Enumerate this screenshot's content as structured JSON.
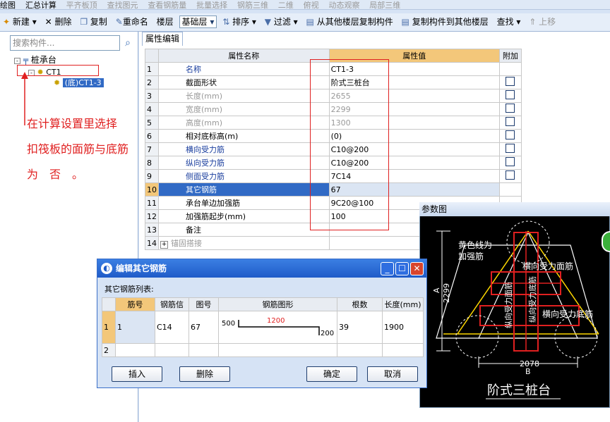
{
  "menu": {
    "items": [
      "绘图",
      "汇总计算",
      "平齐板顶",
      "查找图元",
      "查看钢筋量",
      "批量选择",
      "钢筋三维",
      "二维",
      "俯视",
      "动态观察",
      "局部三维"
    ]
  },
  "toolbar": {
    "new": "新建",
    "delete": "删除",
    "copy": "复制",
    "rename": "重命名",
    "floor_label": "楼层",
    "floor_value": "基础层",
    "sort": "排序",
    "filter": "过滤",
    "copy_from_floor": "从其他楼层复制构件",
    "copy_to_floor": "复制构件到其他楼层",
    "find": "查找",
    "up": "上移"
  },
  "left_panel": {
    "search_placeholder": "搜索构件...",
    "tree": {
      "root": "桩承台",
      "child": "CT1",
      "leaf": "(底)CT1-3"
    }
  },
  "annotation": {
    "line1": "在计算设置里选择",
    "line2": "扣筏板的面筋与底筋",
    "line3": "为　否　。"
  },
  "props": {
    "tab": "属性编辑",
    "col_name": "属性名称",
    "col_value": "属性值",
    "col_extra": "附加",
    "rows": [
      {
        "n": "1",
        "name": "名称",
        "value": "CT1-3",
        "style": "blue",
        "chk": false
      },
      {
        "n": "2",
        "name": "截面形状",
        "value": "阶式三桩台",
        "style": "",
        "chk": true
      },
      {
        "n": "3",
        "name": "长度(mm)",
        "value": "2655",
        "style": "gray",
        "chk": true
      },
      {
        "n": "4",
        "name": "宽度(mm)",
        "value": "2299",
        "style": "gray",
        "chk": true
      },
      {
        "n": "5",
        "name": "高度(mm)",
        "value": "1300",
        "style": "gray",
        "chk": true
      },
      {
        "n": "6",
        "name": "相对底标高(m)",
        "value": "(0)",
        "style": "",
        "chk": true
      },
      {
        "n": "7",
        "name": "横向受力筋",
        "value": "C10@200",
        "style": "blue",
        "chk": true
      },
      {
        "n": "8",
        "name": "纵向受力筋",
        "value": "C10@200",
        "style": "blue",
        "chk": true
      },
      {
        "n": "9",
        "name": "侧面受力筋",
        "value": "7C14",
        "style": "blue",
        "chk": true
      },
      {
        "n": "10",
        "name": "其它钢筋",
        "value": "67",
        "style": "sel",
        "chk": false
      },
      {
        "n": "11",
        "name": "承台单边加强筋",
        "value": "9C20@100",
        "style": "",
        "chk": false
      },
      {
        "n": "12",
        "name": "加强筋起步(mm)",
        "value": "100",
        "style": "",
        "chk": false
      },
      {
        "n": "13",
        "name": "备注",
        "value": "",
        "style": "",
        "chk": false
      },
      {
        "n": "14",
        "name": "锚固搭接",
        "value": "",
        "style": "gray",
        "chk": false
      }
    ]
  },
  "dialog": {
    "title": "编辑其它钢筋",
    "list_label": "其它钢筋列表:",
    "headers": [
      "筋号",
      "钢筋信",
      "图号",
      "钢筋图形",
      "根数",
      "长度(mm)"
    ],
    "row": {
      "n": "1",
      "no": "1",
      "grade": "C14",
      "fig": "67",
      "dim_left": "500",
      "dim_mid": "1200",
      "dim_right": "200",
      "count": "39",
      "length": "1900"
    },
    "row2": "2",
    "insert": "插入",
    "delete": "删除",
    "ok": "确定",
    "cancel": "取消"
  },
  "param_panel": {
    "title": "参数图",
    "yellow_label_1": "黄色线为",
    "yellow_label_2": "加强筋",
    "top_face": "横向受力面筋",
    "bottom_face": "横向受力底筋",
    "vertical_top": "纵向受力面筋",
    "vertical_bottom": "纵向受力底筋",
    "dim_a_value": "2299",
    "dim_a_letter": "A",
    "dim_b_value": "2078",
    "dim_b_letter": "B",
    "shape_name": "阶式三桩台"
  }
}
